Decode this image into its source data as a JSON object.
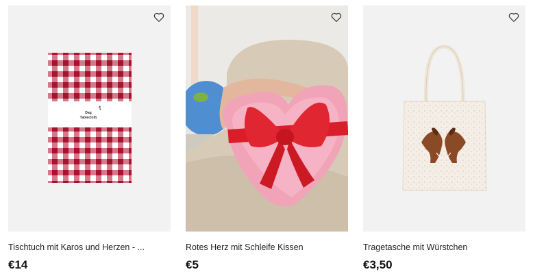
{
  "products": [
    {
      "title": "Tischtuch mit Karos und Herzen - ...",
      "price": "€14",
      "label_lines": [
        "Dag",
        "Tablecloth"
      ]
    },
    {
      "title": "Rotes Herz mit Schleife Kissen",
      "price": "€5"
    },
    {
      "title": "Tragetasche mit Würstchen",
      "price": "€3,50"
    }
  ],
  "icons": {
    "favorite": "heart-outline-icon"
  },
  "colors": {
    "check_red": "#b3203a",
    "pink": "#f2a9bd",
    "bow_red": "#d91e2a",
    "canvas": "#f4eee6"
  }
}
